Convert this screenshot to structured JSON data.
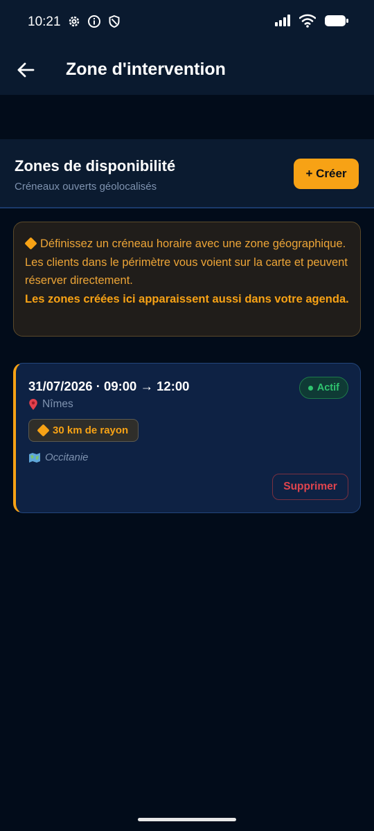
{
  "status_bar": {
    "time": "10:21",
    "left_icons": [
      "gear-icon",
      "info-icon",
      "shield-icon"
    ],
    "right_icons": [
      "signal-icon",
      "wifi-icon",
      "battery-icon"
    ]
  },
  "app_bar": {
    "title": "Zone d'intervention"
  },
  "header": {
    "title": "Zones de disponibilité",
    "subtitle": "Créneaux ouverts géolocalisés",
    "create_label": "+ Créer"
  },
  "info": {
    "text": "Définissez un créneau horaire avec une zone géographique. Les clients dans le périmètre vous voient sur la carte et peuvent réserver directement.",
    "emphasis": "Les zones créées ici apparaissent aussi dans votre agenda."
  },
  "zones": [
    {
      "datetime": "31/07/2026 · 09:00 → 12:00",
      "city": "Nîmes",
      "status": "Actif",
      "radius": "30 km de rayon",
      "region": "Occitanie",
      "delete_label": "Supprimer"
    }
  ],
  "colors": {
    "accent": "#f7a215",
    "background": "#020c1a",
    "card": "#0e2244",
    "active": "#2fc46f",
    "danger": "#e0444e"
  }
}
